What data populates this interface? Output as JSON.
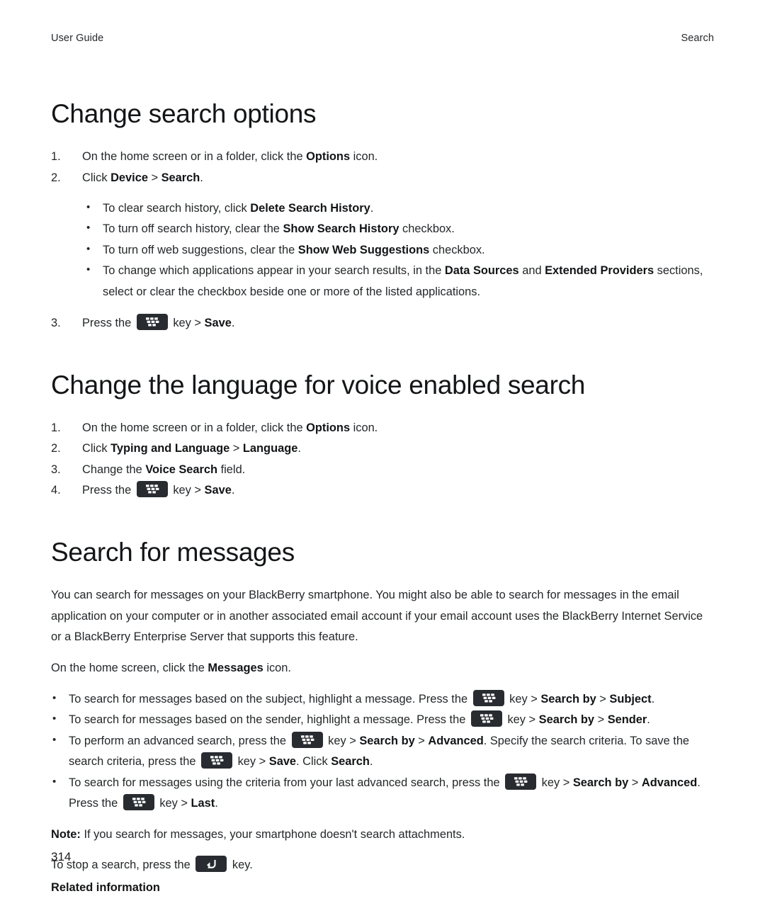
{
  "header": {
    "left": "User Guide",
    "right": "Search"
  },
  "footer": {
    "page_number": "314"
  },
  "icons": {
    "menu_key": "blackberry-menu-key-icon",
    "escape_key": "escape-back-key-icon"
  },
  "sections": [
    {
      "title": "Change search options",
      "steps": [
        {
          "num": "1.",
          "parts": [
            {
              "t": "On the home screen or in a folder, click the ",
              "b": false
            },
            {
              "t": "Options",
              "b": true
            },
            {
              "t": " icon.",
              "b": false
            }
          ]
        },
        {
          "num": "2.",
          "parts": [
            {
              "t": "Click ",
              "b": false
            },
            {
              "t": "Device",
              "b": true
            },
            {
              "t": " > ",
              "b": false
            },
            {
              "t": "Search",
              "b": true
            },
            {
              "t": ".",
              "b": false
            }
          ]
        }
      ],
      "bullets": [
        [
          {
            "t": "To clear search history, click ",
            "b": false
          },
          {
            "t": "Delete Search History",
            "b": true
          },
          {
            "t": ".",
            "b": false
          }
        ],
        [
          {
            "t": "To turn off search history, clear the ",
            "b": false
          },
          {
            "t": "Show Search History",
            "b": true
          },
          {
            "t": " checkbox.",
            "b": false
          }
        ],
        [
          {
            "t": "To turn off web suggestions, clear the ",
            "b": false
          },
          {
            "t": "Show Web Suggestions",
            "b": true
          },
          {
            "t": " checkbox.",
            "b": false
          }
        ],
        [
          {
            "t": "To change which applications appear in your search results, in the ",
            "b": false
          },
          {
            "t": "Data Sources",
            "b": true
          },
          {
            "t": " and ",
            "b": false
          },
          {
            "t": "Extended Providers",
            "b": true
          },
          {
            "t": " sections, select or clear the checkbox beside one or more of the listed applications.",
            "b": false
          }
        ]
      ],
      "final_step": {
        "num": "3.",
        "parts": [
          {
            "t": "Press the ",
            "b": false
          },
          {
            "key": "menu"
          },
          {
            "t": " key > ",
            "b": false
          },
          {
            "t": "Save",
            "b": true
          },
          {
            "t": ".",
            "b": false
          }
        ]
      }
    },
    {
      "title": "Change the language for voice enabled search",
      "steps": [
        {
          "num": "1.",
          "parts": [
            {
              "t": "On the home screen or in a folder, click the ",
              "b": false
            },
            {
              "t": "Options",
              "b": true
            },
            {
              "t": " icon.",
              "b": false
            }
          ]
        },
        {
          "num": "2.",
          "parts": [
            {
              "t": "Click ",
              "b": false
            },
            {
              "t": "Typing and Language",
              "b": true
            },
            {
              "t": " > ",
              "b": false
            },
            {
              "t": "Language",
              "b": true
            },
            {
              "t": ".",
              "b": false
            }
          ]
        },
        {
          "num": "3.",
          "parts": [
            {
              "t": "Change the ",
              "b": false
            },
            {
              "t": "Voice Search",
              "b": true
            },
            {
              "t": " field.",
              "b": false
            }
          ]
        },
        {
          "num": "4.",
          "parts": [
            {
              "t": "Press the ",
              "b": false
            },
            {
              "key": "menu"
            },
            {
              "t": " key > ",
              "b": false
            },
            {
              "t": "Save",
              "b": true
            },
            {
              "t": ".",
              "b": false
            }
          ]
        }
      ]
    },
    {
      "title": "Search for messages",
      "paragraphs": [
        "You can search for messages on your BlackBerry smartphone. You might also be able to search for messages in the email application on your computer or in another associated email account if your email account uses the BlackBerry Internet Service or a BlackBerry Enterprise Server that supports this feature."
      ],
      "lead_in": [
        {
          "t": "On the home screen, click the ",
          "b": false
        },
        {
          "t": "Messages",
          "b": true
        },
        {
          "t": " icon.",
          "b": false
        }
      ],
      "bullets": [
        [
          {
            "t": "To search for messages based on the subject, highlight a message. Press the ",
            "b": false
          },
          {
            "key": "menu"
          },
          {
            "t": " key > ",
            "b": false
          },
          {
            "t": "Search by",
            "b": true
          },
          {
            "t": " > ",
            "b": false
          },
          {
            "t": "Subject",
            "b": true
          },
          {
            "t": ".",
            "b": false
          }
        ],
        [
          {
            "t": "To search for messages based on the sender, highlight a message. Press the ",
            "b": false
          },
          {
            "key": "menu"
          },
          {
            "t": " key > ",
            "b": false
          },
          {
            "t": "Search by",
            "b": true
          },
          {
            "t": " > ",
            "b": false
          },
          {
            "t": "Sender",
            "b": true
          },
          {
            "t": ".",
            "b": false
          }
        ],
        [
          {
            "t": "To perform an advanced search, press the ",
            "b": false
          },
          {
            "key": "menu"
          },
          {
            "t": " key > ",
            "b": false
          },
          {
            "t": "Search by",
            "b": true
          },
          {
            "t": " > ",
            "b": false
          },
          {
            "t": "Advanced",
            "b": true
          },
          {
            "t": ". Specify the search criteria. To save the search criteria, press the ",
            "b": false
          },
          {
            "key": "menu"
          },
          {
            "t": " key > ",
            "b": false
          },
          {
            "t": "Save",
            "b": true
          },
          {
            "t": ". Click ",
            "b": false
          },
          {
            "t": "Search",
            "b": true
          },
          {
            "t": ".",
            "b": false
          }
        ],
        [
          {
            "t": "To search for messages using the criteria from your last advanced search, press the ",
            "b": false
          },
          {
            "key": "menu"
          },
          {
            "t": " key > ",
            "b": false
          },
          {
            "t": "Search by",
            "b": true
          },
          {
            "t": " > ",
            "b": false
          },
          {
            "t": "Advanced",
            "b": true
          },
          {
            "t": ". Press the ",
            "b": false
          },
          {
            "key": "menu"
          },
          {
            "t": " key > ",
            "b": false
          },
          {
            "t": "Last",
            "b": true
          },
          {
            "t": ".",
            "b": false
          }
        ]
      ],
      "note": [
        {
          "t": "Note:",
          "b": true
        },
        {
          "t": " If you search for messages, your smartphone doesn't search attachments.",
          "b": false
        }
      ],
      "stop_search": [
        {
          "t": "To stop a search, press the ",
          "b": false
        },
        {
          "key": "escape"
        },
        {
          "t": " key.",
          "b": false
        }
      ],
      "related_information": "Related information"
    }
  ]
}
